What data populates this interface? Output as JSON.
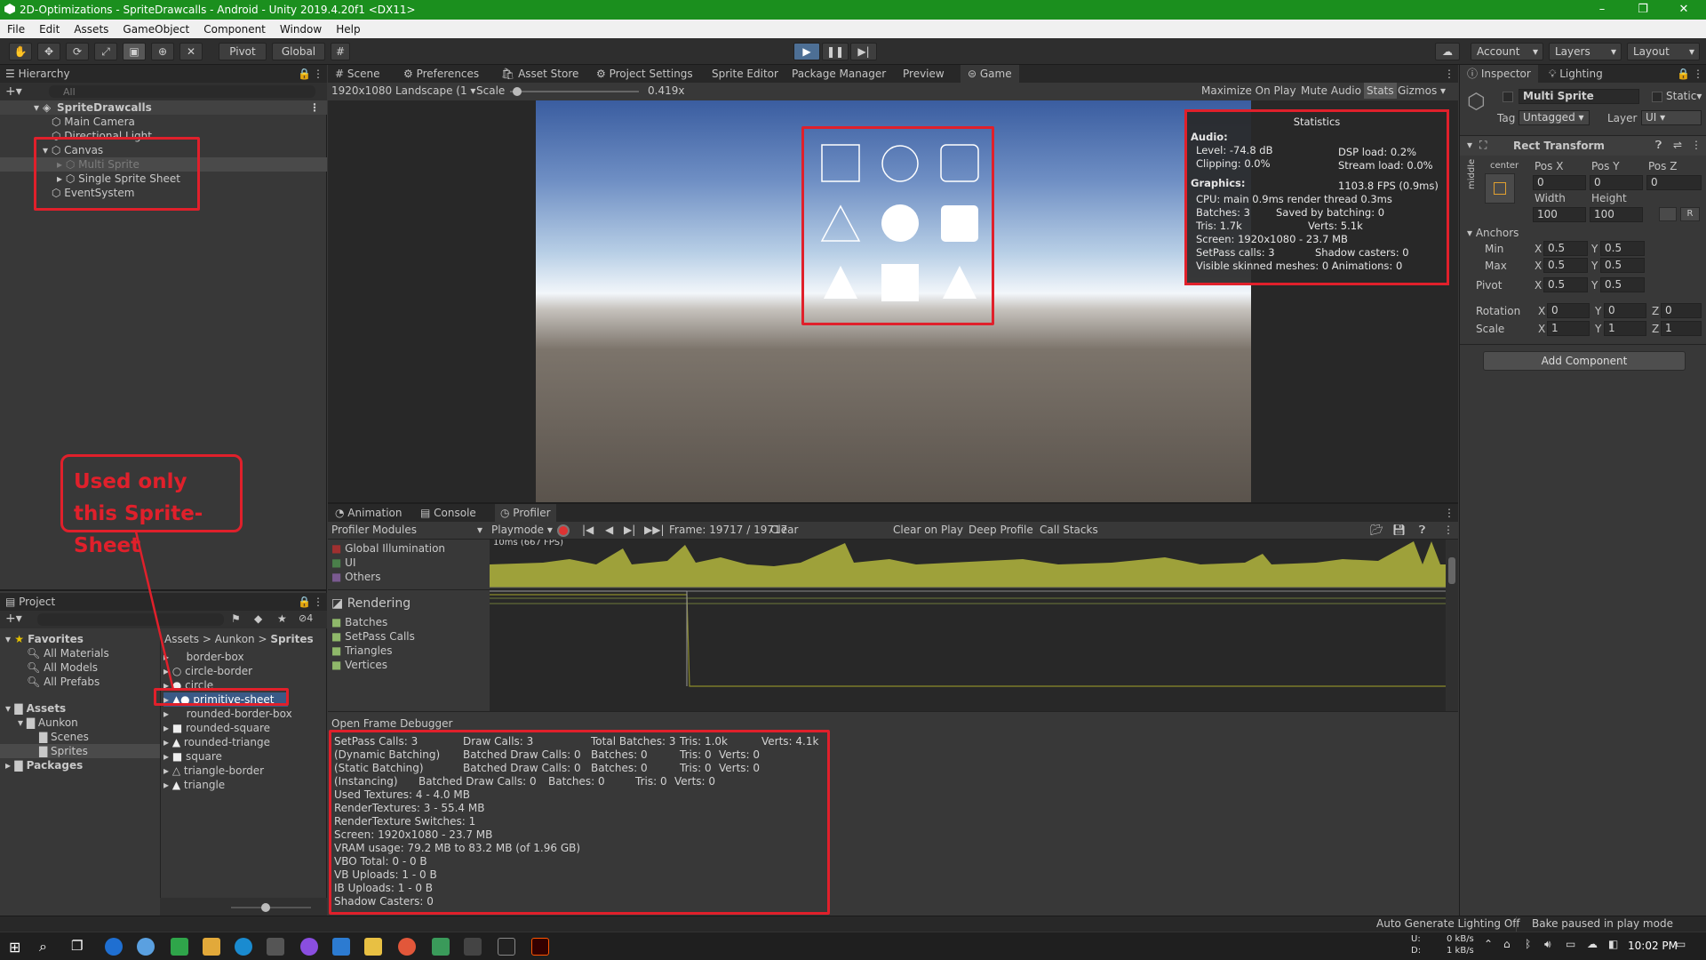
{
  "window": {
    "title": "2D-Optimizations - SpriteDrawcalls - Android - Unity 2019.4.20f1 <DX11>",
    "min": "–",
    "max": "❐",
    "close": "✕"
  },
  "menu": [
    "File",
    "Edit",
    "Assets",
    "GameObject",
    "Component",
    "Window",
    "Help"
  ],
  "toolbar": {
    "pivot": "Pivot",
    "global": "Global",
    "account": "Account",
    "layers": "Layers",
    "layout": "Layout"
  },
  "hierarchy": {
    "title": "Hierarchy",
    "search_placeholder": "All",
    "scene": "SpriteDrawcalls",
    "items": [
      "Main Camera",
      "Directional Light",
      "Canvas",
      "Multi Sprite",
      "Single Sprite Sheet",
      "EventSystem"
    ]
  },
  "center_tabs": [
    "Scene",
    "Preferences",
    "Asset Store",
    "Project Settings",
    "Sprite Editor",
    "Package Manager",
    "Preview",
    "Game"
  ],
  "game": {
    "resolution": "1920x1080 Landscape (1",
    "scale_label": "Scale",
    "scale_value": "0.419x",
    "scale_fraction": 0.02,
    "buttons": [
      "Maximize On Play",
      "Mute Audio",
      "Stats",
      "Gizmos"
    ]
  },
  "stats": {
    "title": "Statistics",
    "audio_h": "Audio:",
    "level": "Level: -74.8 dB",
    "dsp": "DSP load: 0.2%",
    "clipping": "Clipping: 0.0%",
    "stream": "Stream load: 0.0%",
    "graphics_h": "Graphics:",
    "fps": "1103.8 FPS (0.9ms)",
    "cpu": "CPU: main 0.9ms  render thread 0.3ms",
    "batches": "Batches: 3",
    "saved": "Saved by batching: 0",
    "tris": "Tris: 1.7k",
    "verts": "Verts: 5.1k",
    "screen": "Screen: 1920x1080 - 23.7 MB",
    "setpass": "SetPass calls: 3",
    "shadow": "Shadow casters: 0",
    "skinned": "Visible skinned meshes: 0  Animations: 0"
  },
  "inspector": {
    "tabs": [
      "Inspector",
      "Lighting"
    ],
    "object_name": "Multi Sprite",
    "static": "Static",
    "tag_label": "Tag",
    "tag_value": "Untagged",
    "layer_label": "Layer",
    "layer_value": "UI",
    "component": "Rect Transform",
    "anchor_h": "center",
    "anchor_v": "middle",
    "posx_label": "Pos X",
    "posy_label": "Pos Y",
    "posz_label": "Pos Z",
    "posx": "0",
    "posy": "0",
    "posz": "0",
    "width_label": "Width",
    "height_label": "Height",
    "width": "100",
    "height": "100",
    "anchors_label": "Anchors",
    "min_label": "Min",
    "max_label": "Max",
    "pivot_label": "Pivot",
    "rotation_label": "Rotation",
    "scale_label": "Scale",
    "x": "X",
    "y": "Y",
    "z": "Z",
    "r": "R",
    "min_x": "0.5",
    "min_y": "0.5",
    "max_x": "0.5",
    "max_y": "0.5",
    "pivot_x": "0.5",
    "pivot_y": "0.5",
    "rot_x": "0",
    "rot_y": "0",
    "rot_z": "0",
    "scale_x": "1",
    "scale_y": "1",
    "scale_z": "1",
    "add_component": "Add Component"
  },
  "bottom_tabs": [
    "Animation",
    "Console",
    "Profiler"
  ],
  "profiler": {
    "modules": "Profiler Modules",
    "playmode": "Playmode",
    "frame": "Frame: 19717 / 19717",
    "clear": "Clear",
    "clear_on_play": "Clear on Play",
    "deep_profile": "Deep Profile",
    "call_stacks": "Call Stacks",
    "cpu_items": [
      "Global Illumination",
      "UI",
      "Others"
    ],
    "chart_label": "10ms (667 FPS)",
    "rendering": "Rendering",
    "render_items": [
      "Batches",
      "SetPass Calls",
      "Triangles",
      "Vertices"
    ],
    "open_frame_debugger": "Open Frame Debugger"
  },
  "frame_stats": {
    "setpass": "SetPass Calls: 3",
    "draw_calls": "Draw Calls: 3",
    "total_batches": "Total Batches: 3",
    "tris": "Tris: 1.0k",
    "verts": "Verts: 4.1k",
    "dyn_label": "(Dynamic Batching)",
    "static_label": "(Static Batching)",
    "inst_label": "(Instancing)",
    "batched_dc": "Batched Draw Calls: 0",
    "batches0": "Batches: 0",
    "tris0": "Tris: 0",
    "verts0": "Verts: 0",
    "used_textures": "Used Textures: 4 - 4.0 MB",
    "render_textures": "RenderTextures: 3 - 55.4 MB",
    "rt_switches": "RenderTexture Switches: 1",
    "screen": "Screen: 1920x1080 - 23.7 MB",
    "vram": "VRAM usage: 79.2 MB to 83.2 MB (of 1.96 GB)",
    "vbo": "VBO Total: 0 - 0 B",
    "vb_uploads": "VB Uploads: 1 - 0 B",
    "ib_uploads": "IB Uploads: 1 - 0 B",
    "shadow": "Shadow Casters: 0"
  },
  "project": {
    "title": "Project",
    "hidden_count": "4",
    "favorites": "Favorites",
    "fav_items": [
      "All Materials",
      "All Models",
      "All Prefabs"
    ],
    "assets": "Assets",
    "aunkon": "Aunkon",
    "scenes": "Scenes",
    "sprites": "Sprites",
    "packages": "Packages",
    "breadcrumb": [
      "Assets",
      "Aunkon",
      "Sprites"
    ],
    "files": [
      "border-box",
      "circle-border",
      "circle",
      "primitive-sheet",
      "rounded-border-box",
      "rounded-square",
      "rounded-triange",
      "square",
      "triangle-border",
      "triangle"
    ]
  },
  "annotation": "Used only this Sprite-Sheet",
  "statusbar": {
    "lighting": "Auto Generate Lighting Off",
    "bake": "Bake paused in play mode"
  },
  "taskbar": {
    "drive_u": "U:",
    "drive_d": "D:",
    "net_up": "0 kB/s",
    "net_down": "1 kB/s",
    "time": "10:02 PM"
  }
}
